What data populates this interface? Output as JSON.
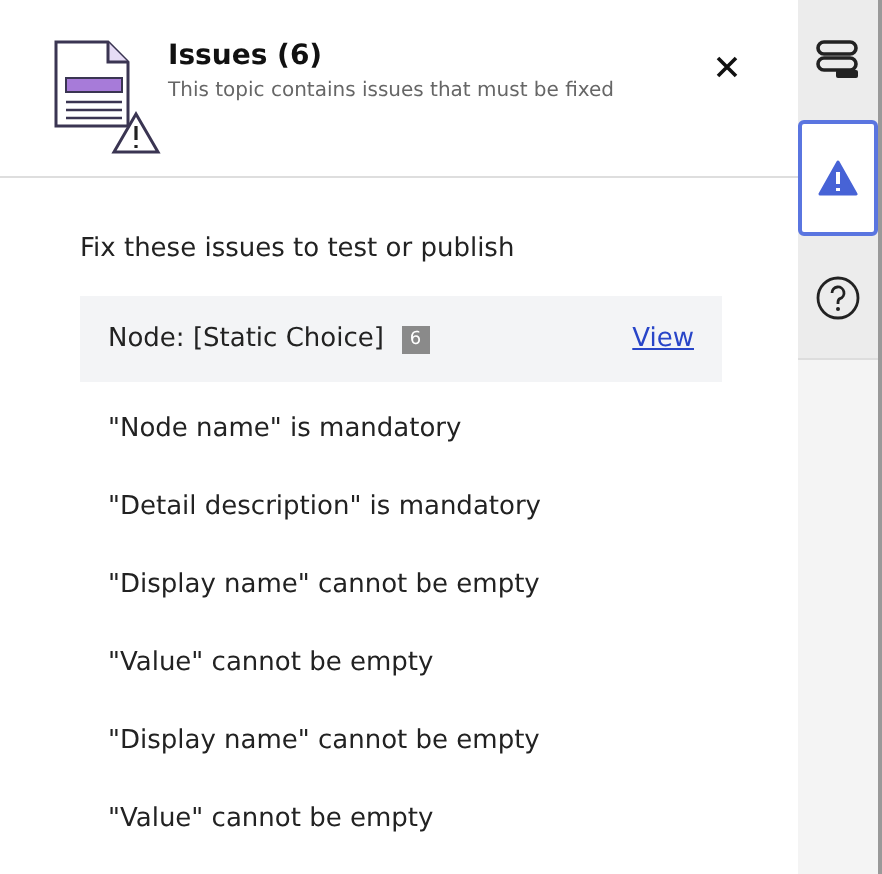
{
  "header": {
    "title": "Issues (6)",
    "subtitle": "This topic contains issues that must be fixed"
  },
  "intro": "Fix these issues to test or publish",
  "group": {
    "label": "Node: [Static Choice]",
    "count": "6",
    "link": "View"
  },
  "issues": [
    "\"Node name\" is mandatory",
    "\"Detail description\" is mandatory",
    "\"Display name\" cannot be empty",
    "\"Value\" cannot be empty",
    "\"Display name\" cannot be empty",
    "\"Value\" cannot be empty"
  ],
  "rail": [
    {
      "kind": "layers",
      "selected": false
    },
    {
      "kind": "warning",
      "selected": true
    },
    {
      "kind": "help",
      "selected": false
    }
  ]
}
